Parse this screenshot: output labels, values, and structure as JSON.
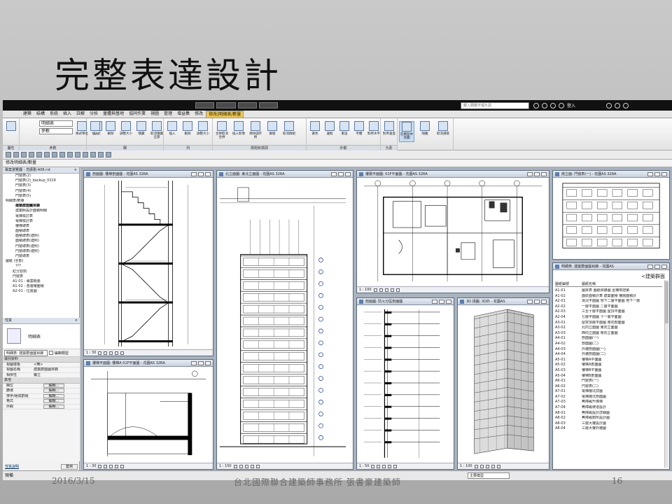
{
  "slide": {
    "title": "完整表達設計",
    "footer_date": "2016/3/15",
    "footer_org": "台北國際聯合建築師事務所 張書豪建築師",
    "page_number": "16"
  },
  "window": {
    "search_placeholder": "鍵入關鍵字或片語",
    "user": "登入"
  },
  "tabs": [
    "建築",
    "結構",
    "系統",
    "插入",
    "註解",
    "分析",
    "量體與基地",
    "協同作業",
    "視圖",
    "管理",
    "增益集",
    "修改",
    "修改|明細表/數量"
  ],
  "active_tab": "修改|明細表/數量",
  "ribbon": {
    "dropdown_a": "明細表",
    "dropdown_b": "參數",
    "buttons": [
      "格式單位",
      "公式",
      "插入",
      "刪除",
      "調整大小",
      "隱藏",
      "取消隱藏全部",
      "插入",
      "刪除",
      "調整大小",
      "合併取消合併",
      "插入影像",
      "清除儲存格",
      "群組",
      "取消群組",
      "著色",
      "邊框",
      "重設",
      "字體",
      "對齊水平",
      "對齊垂直",
      "在模型中亮顯",
      "隔離",
      "取消選取"
    ],
    "groups": [
      "屬性",
      "參數",
      "欄",
      "列",
      "標題和標頭",
      "外觀",
      "元素"
    ]
  },
  "options_bar": "修改明細表/數量",
  "project_browser": {
    "title": "專案瀏覽器 - 范振剛-A06.rvt",
    "items": [
      "門窗表(2)",
      "門窗表(2)_backup_0316",
      "門窗表(3)",
      "門窗表(4)",
      "門窗表(5)",
      "明細表/數量",
      "建築群面圖目錄",
      "建築師設計面積明細",
      "電梯檢討表",
      "電梯檢討表",
      "樓梯總表",
      "面積總表",
      "面積總表(建照)",
      "面積總表(建照)",
      "門窗總表(建照)",
      "門窗總表(建照)",
      "門窗總表",
      "圖紙 (全部)",
      "???",
      "紅分割刻",
      "門窗表",
      "A1-01 - 專案概要",
      "A1-02 - 各層樓面積",
      "A2-01 - 位置圖"
    ]
  },
  "properties": {
    "title": "性質",
    "type_name": "明細表",
    "type_dropdown": "明細表: 建築群面圖目錄",
    "edit_type": "編輯類型",
    "group_identity": "識別資料",
    "rows": [
      {
        "name": "視圖樣板",
        "value": "<無>"
      },
      {
        "name": "視圖名稱",
        "value": "建築群面圖目錄"
      },
      {
        "name": "相依性",
        "value": "獨立"
      }
    ],
    "group_other": "其他",
    "other_rows": [
      {
        "name": "欄位",
        "value": "編輯..."
      },
      {
        "name": "篩選",
        "value": "編輯..."
      },
      {
        "name": "排序/組成群組",
        "value": "編輯..."
      },
      {
        "name": "格式",
        "value": "編輯..."
      },
      {
        "name": "外觀",
        "value": "編輯..."
      }
    ],
    "help": "性質說明",
    "apply": "套用"
  },
  "views": {
    "section": {
      "title": "剖面圖: 樓梯剖面圖 - 花園AS 32RA",
      "scale": "1 : 30"
    },
    "north": {
      "title": "北立面圖: 東北立面圖 - 花園AS 32RA",
      "scale": "1 : 150"
    },
    "plan": {
      "title": "樓層平面圖: 01F平面圖 - 花園AS 32RA",
      "scale": "1 : 100"
    },
    "south": {
      "title": "南立面: 門窗表(一) - 花園AS 32RA",
      "scale": ""
    },
    "stair_plan": {
      "title": "樓梯平面圖: 樓梯A 01F平面圖 - 花園AS 32RA",
      "scale": "1 : 30"
    },
    "detail": {
      "title": "剖面圖: 防火分區剖面圖",
      "scale": "1 : 50"
    },
    "view3d": {
      "title": "3D 視圖: 3D外 - 花園AS",
      "scale": "1 : 100"
    }
  },
  "schedule": {
    "title_bar": "明細表: 建築群面圖目錄 - 花園AS",
    "title": "<建築群面",
    "headers": [
      "圖紙編號",
      "圖紙名稱"
    ],
    "rows": [
      [
        "A1-01",
        "圖目表 圖紙目錄圖 壹棟辯證第"
      ],
      [
        "A1-02",
        "面紋面積計算 建築面積 樓層面積計"
      ],
      [
        "A2-01",
        "現況平面圖 地下二層平面圖 地下一層"
      ],
      [
        "A2-02",
        "一層平面圖 二層平面圖"
      ],
      [
        "A2-03",
        "三至十層平面圖 屋頂平面圖"
      ],
      [
        "A2-04",
        "七層平面圖 十一層平面圖"
      ],
      [
        "A3-01",
        "屋突頂層平面圖 南向剖面圖"
      ],
      [
        "A3-02",
        "北向立面圖 東向立面圖"
      ],
      [
        "A3-03",
        "西向立面圖 南向立面圖"
      ],
      [
        "A4-01",
        "剖面圖(一)"
      ],
      [
        "A4-02",
        "剖面圖(二)"
      ],
      [
        "A4-03",
        "外牆剖面圖(一)"
      ],
      [
        "A4-04",
        "外牆剖面圖(二)"
      ],
      [
        "A5-01",
        "樓梯A平面圖"
      ],
      [
        "A5-02",
        "樓梯A剖面圖"
      ],
      [
        "A5-03",
        "樓梯B平面圖"
      ],
      [
        "A5-04",
        "樓梯B剖面圖"
      ],
      [
        "A6-01",
        "門窗表(一)"
      ],
      [
        "A6-02",
        "門窗表(二)"
      ],
      [
        "A7-01",
        "電梯機坑詳圖"
      ],
      [
        "A7-02",
        "電梯機坑剖面圖"
      ],
      [
        "A7-03",
        "無障礙升降梯"
      ],
      [
        "A7-04",
        "無障礙坡道設計"
      ],
      [
        "A8-01",
        "無障礙設計詳細圖"
      ],
      [
        "A8-02",
        "無障礙廁所設計圖"
      ],
      [
        "A8-03",
        "三層大樓設計圖"
      ],
      [
        "A8-04",
        "三層大樓外牆圖"
      ]
    ]
  },
  "status": {
    "text": "預備",
    "model": "主要模型"
  }
}
